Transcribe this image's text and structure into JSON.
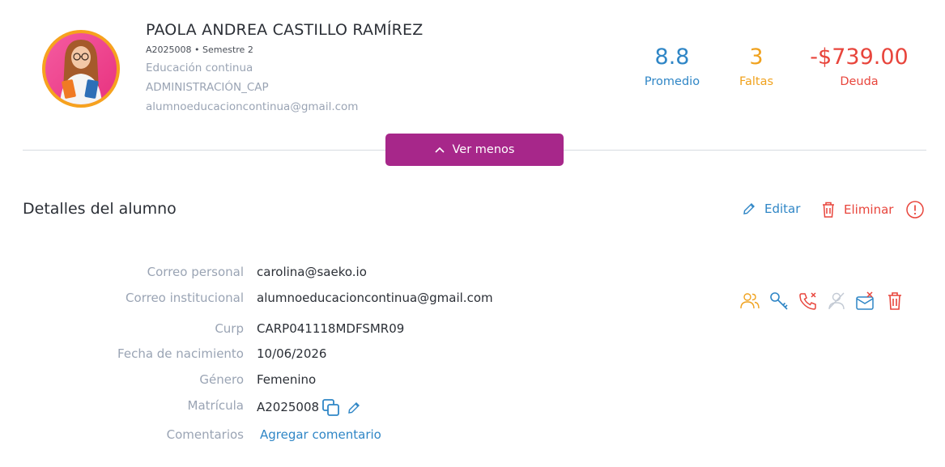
{
  "student": {
    "name": "PAOLA ANDREA CASTILLO RAMÍREZ",
    "id_semester": "A2025008 • Semestre 2",
    "program": "Educación continua",
    "campus": "ADMINISTRACIÓN_CAP",
    "email": "alumnoeducacioncontinua@gmail.com"
  },
  "stats": [
    {
      "value": "8.8",
      "label": "Promedio",
      "color": "#2f86c6"
    },
    {
      "value": "3",
      "label": "Faltas",
      "color": "#f0a21e"
    },
    {
      "value": "-$739.00",
      "label": "Deuda",
      "color": "#e8453c"
    }
  ],
  "toggle_button": {
    "label": "Ver menos",
    "icon": "chevron-up-icon",
    "color": "#a7278a"
  },
  "details": {
    "title": "Detalles del alumno",
    "edit_label": "Editar",
    "delete_label": "Eliminar",
    "fields": [
      {
        "label": "Correo personal",
        "value": "carolina@saeko.io"
      },
      {
        "label": "Correo institucional",
        "value": "alumnoeducacioncontinua@gmail.com"
      },
      {
        "label": "Curp",
        "value": "CARP041118MDFSMR09"
      },
      {
        "label": "Fecha de nacimiento",
        "value": "10/06/2026"
      },
      {
        "label": "Género",
        "value": "Femenino"
      },
      {
        "label": "Matrícula",
        "value": "A2025008"
      },
      {
        "label": "Comentarios",
        "value": "Agregar comentario"
      }
    ],
    "row_actions": [
      "users-icon",
      "key-icon",
      "phone-cancel-icon",
      "user-off-icon",
      "mail-off-icon",
      "trash-icon"
    ]
  }
}
